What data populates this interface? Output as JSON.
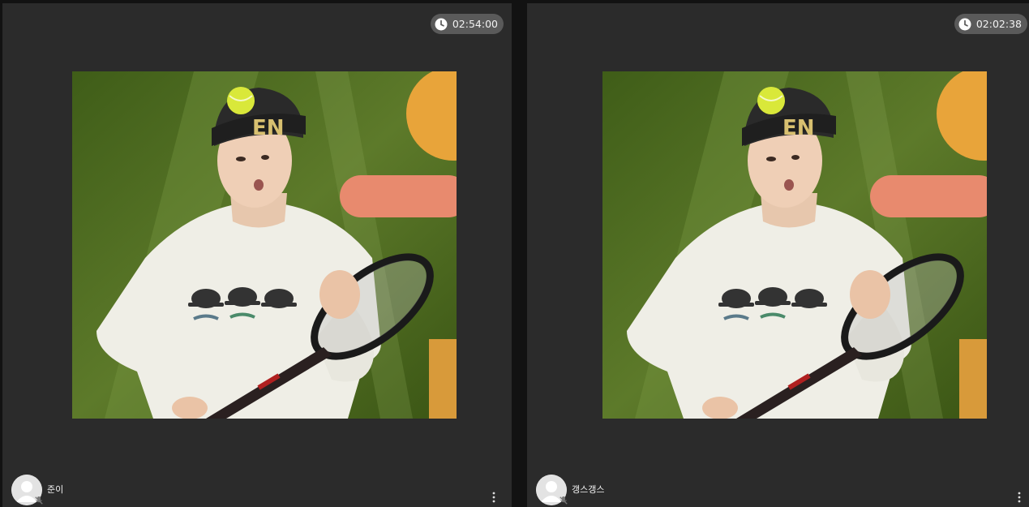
{
  "participants": [
    {
      "name": "준이",
      "duration": "02:54:00",
      "video_icon": "person-with-tennis-racket",
      "avatar_icon": "default-user-avatar-icon",
      "mic_icon": "mic-off-icon"
    },
    {
      "name": "갱스갱스",
      "duration": "02:02:38",
      "video_icon": "person-with-tennis-racket",
      "avatar_icon": "default-user-avatar-icon",
      "mic_icon": "mic-off-icon"
    }
  ],
  "colors": {
    "tile_background": "#2b2b2b",
    "page_background": "#121212",
    "timer_badge": "#5a5a5a",
    "video_green": "#4c6a1e",
    "text": "#f0f0f0"
  }
}
